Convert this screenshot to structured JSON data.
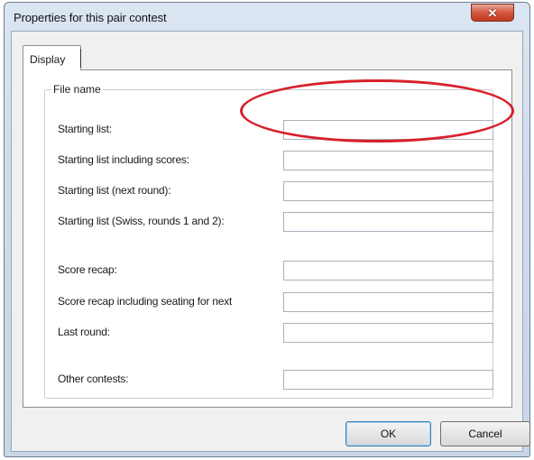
{
  "window": {
    "title": "Properties for this pair contest",
    "close_icon": "close-icon",
    "close_glyph": "✕"
  },
  "tabs": [
    {
      "label": "Display",
      "selected": true
    }
  ],
  "group": {
    "legend": "File name",
    "fields": [
      {
        "label": "Starting list:",
        "value": ""
      },
      {
        "label": "Starting list including scores:",
        "value": ""
      },
      {
        "label": "Starting list (next round):",
        "value": ""
      },
      {
        "label": "Starting list (Swiss, rounds 1 and 2):",
        "value": ""
      },
      {
        "label": "Score recap:",
        "value": ""
      },
      {
        "label": "Score recap including seating for next",
        "value": ""
      },
      {
        "label": "Last round:",
        "value": ""
      },
      {
        "label": "Other contests:",
        "value": ""
      }
    ]
  },
  "annotation": {
    "color": "#d8202a",
    "shape": "ellipse"
  },
  "buttons": {
    "ok": "OK",
    "cancel": "Cancel"
  }
}
